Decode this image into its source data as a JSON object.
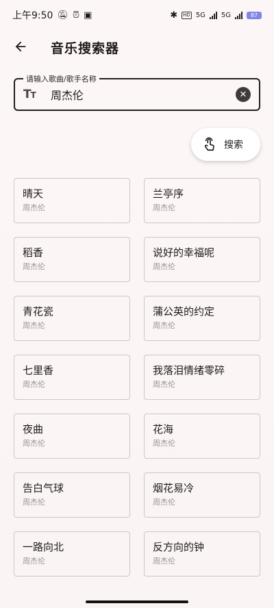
{
  "status_bar": {
    "time": "上午9:50",
    "network_1": "5G",
    "network_2": "5G",
    "battery": "87",
    "hd": "HD"
  },
  "app_bar": {
    "title": "音乐搜索器"
  },
  "search": {
    "label": "请输入歌曲/歌手名称",
    "value": "周杰伦",
    "button_label": "搜索"
  },
  "results": [
    {
      "title": "晴天",
      "artist": "周杰伦"
    },
    {
      "title": "兰亭序",
      "artist": "周杰伦"
    },
    {
      "title": "稻香",
      "artist": "周杰伦"
    },
    {
      "title": "说好的幸福呢",
      "artist": "周杰伦"
    },
    {
      "title": "青花瓷",
      "artist": "周杰伦"
    },
    {
      "title": "蒲公英的约定",
      "artist": "周杰伦"
    },
    {
      "title": "七里香",
      "artist": "周杰伦"
    },
    {
      "title": "我落泪情绪零碎",
      "artist": "周杰伦"
    },
    {
      "title": "夜曲",
      "artist": "周杰伦"
    },
    {
      "title": "花海",
      "artist": "周杰伦"
    },
    {
      "title": "告白气球",
      "artist": "周杰伦"
    },
    {
      "title": "烟花易冷",
      "artist": "周杰伦"
    },
    {
      "title": "一路向北",
      "artist": "周杰伦"
    },
    {
      "title": "反方向的钟",
      "artist": "周杰伦"
    }
  ]
}
